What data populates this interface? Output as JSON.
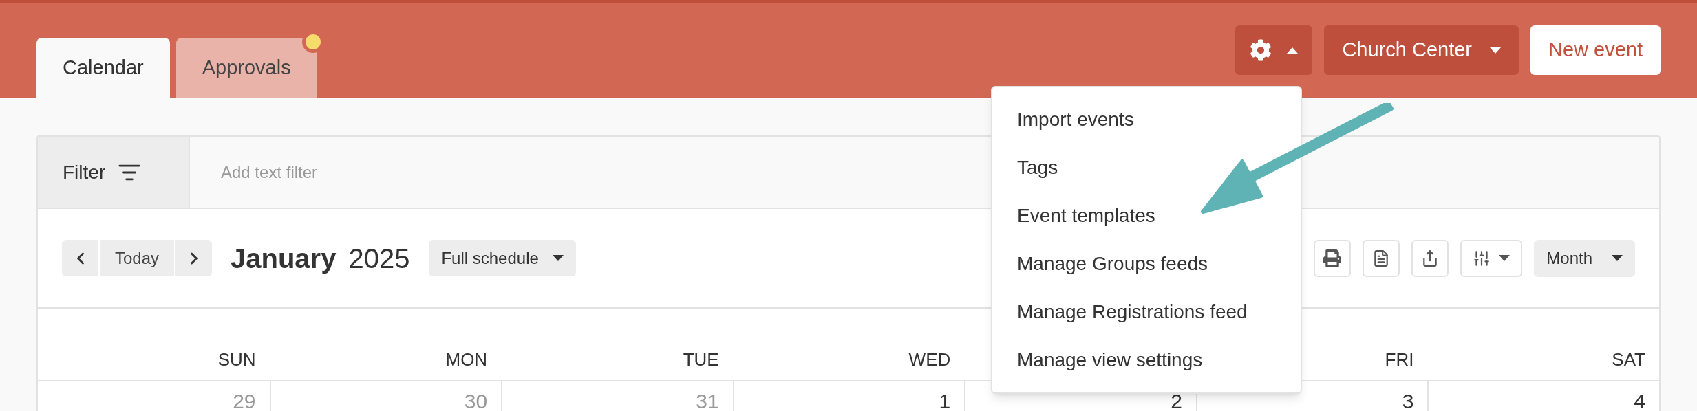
{
  "tabs": [
    {
      "label": "Calendar",
      "selected": true,
      "notification": false
    },
    {
      "label": "Approvals",
      "selected": false,
      "notification": true
    }
  ],
  "header_actions": {
    "settings_expanded": true,
    "calendar_button": "Church Center",
    "new_button": "New event"
  },
  "settings_menu": [
    "Import events",
    "Tags",
    "Event templates",
    "Manage Groups feeds",
    "Manage Registrations feed",
    "Manage view settings"
  ],
  "filter": {
    "label": "Filter",
    "placeholder": "Add text filter"
  },
  "toolbar": {
    "today": "Today",
    "month": "January",
    "year": "2025",
    "schedule": "Full schedule",
    "view": "Month"
  },
  "days": [
    {
      "weekday": "SUN",
      "label": "29",
      "muted": true
    },
    {
      "weekday": "MON",
      "label": "30",
      "muted": true
    },
    {
      "weekday": "TUE",
      "label": "31",
      "muted": true
    },
    {
      "weekday": "WED",
      "label": "1",
      "muted": false
    },
    {
      "label": "2",
      "muted": false
    },
    {
      "weekday": "FRI",
      "label": "3",
      "muted": false
    },
    {
      "weekday": "SAT",
      "label": "4",
      "muted": false
    }
  ]
}
